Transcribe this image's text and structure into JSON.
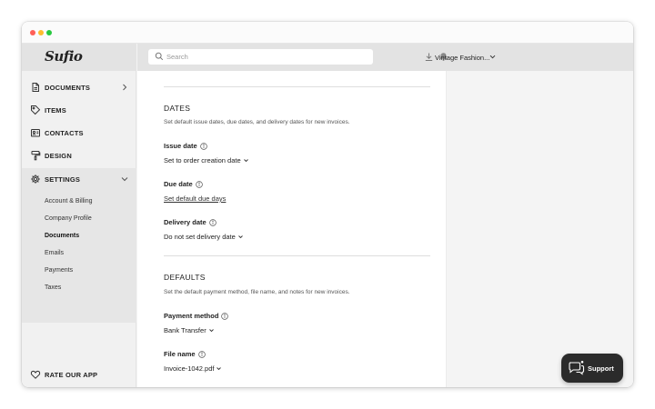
{
  "window": {
    "dots": [
      "#ff5f57",
      "#febc2e",
      "#28c840"
    ]
  },
  "app": {
    "logo": "Sufio"
  },
  "sidebar": {
    "items": [
      {
        "label": "DOCUMENTS",
        "icon": "document-icon",
        "has_chevron": true
      },
      {
        "label": "ITEMS",
        "icon": "tag-icon"
      },
      {
        "label": "CONTACTS",
        "icon": "contacts-card-icon"
      },
      {
        "label": "DESIGN",
        "icon": "paint-roller-icon"
      },
      {
        "label": "SETTINGS",
        "icon": "gear-icon",
        "expanded": true
      }
    ],
    "settings_sub": [
      {
        "label": "Account & Billing"
      },
      {
        "label": "Company Profile"
      },
      {
        "label": "Documents",
        "active": true
      },
      {
        "label": "Emails"
      },
      {
        "label": "Payments"
      },
      {
        "label": "Taxes"
      }
    ],
    "rate": {
      "label": "RATE OUR APP",
      "icon": "heart-icon"
    }
  },
  "topbar": {
    "search_placeholder": "Search",
    "account_name": "Vintage Fashion...",
    "icons": [
      "download-icon",
      "bell-icon"
    ]
  },
  "content": {
    "dates": {
      "title": "DATES",
      "description": "Set default issue dates, due dates, and delivery dates for new invoices.",
      "issue_label": "Issue date",
      "issue_value": "Set to order creation date",
      "due_label": "Due date",
      "due_link": "Set default due days",
      "delivery_label": "Delivery date",
      "delivery_value": "Do not set delivery date"
    },
    "defaults": {
      "title": "DEFAULTS",
      "description": "Set the default payment method, file name, and notes for new invoices.",
      "payment_label": "Payment method",
      "payment_value": "Bank Transfer",
      "file_label": "File name",
      "file_value": "Invoice-1042.pdf"
    }
  },
  "support": {
    "label": "Support"
  },
  "colors": {
    "accent_dark": "#2b2b2b",
    "sidebar_bg": "#f1f1f1",
    "settings_bg": "#e6e6e6"
  }
}
